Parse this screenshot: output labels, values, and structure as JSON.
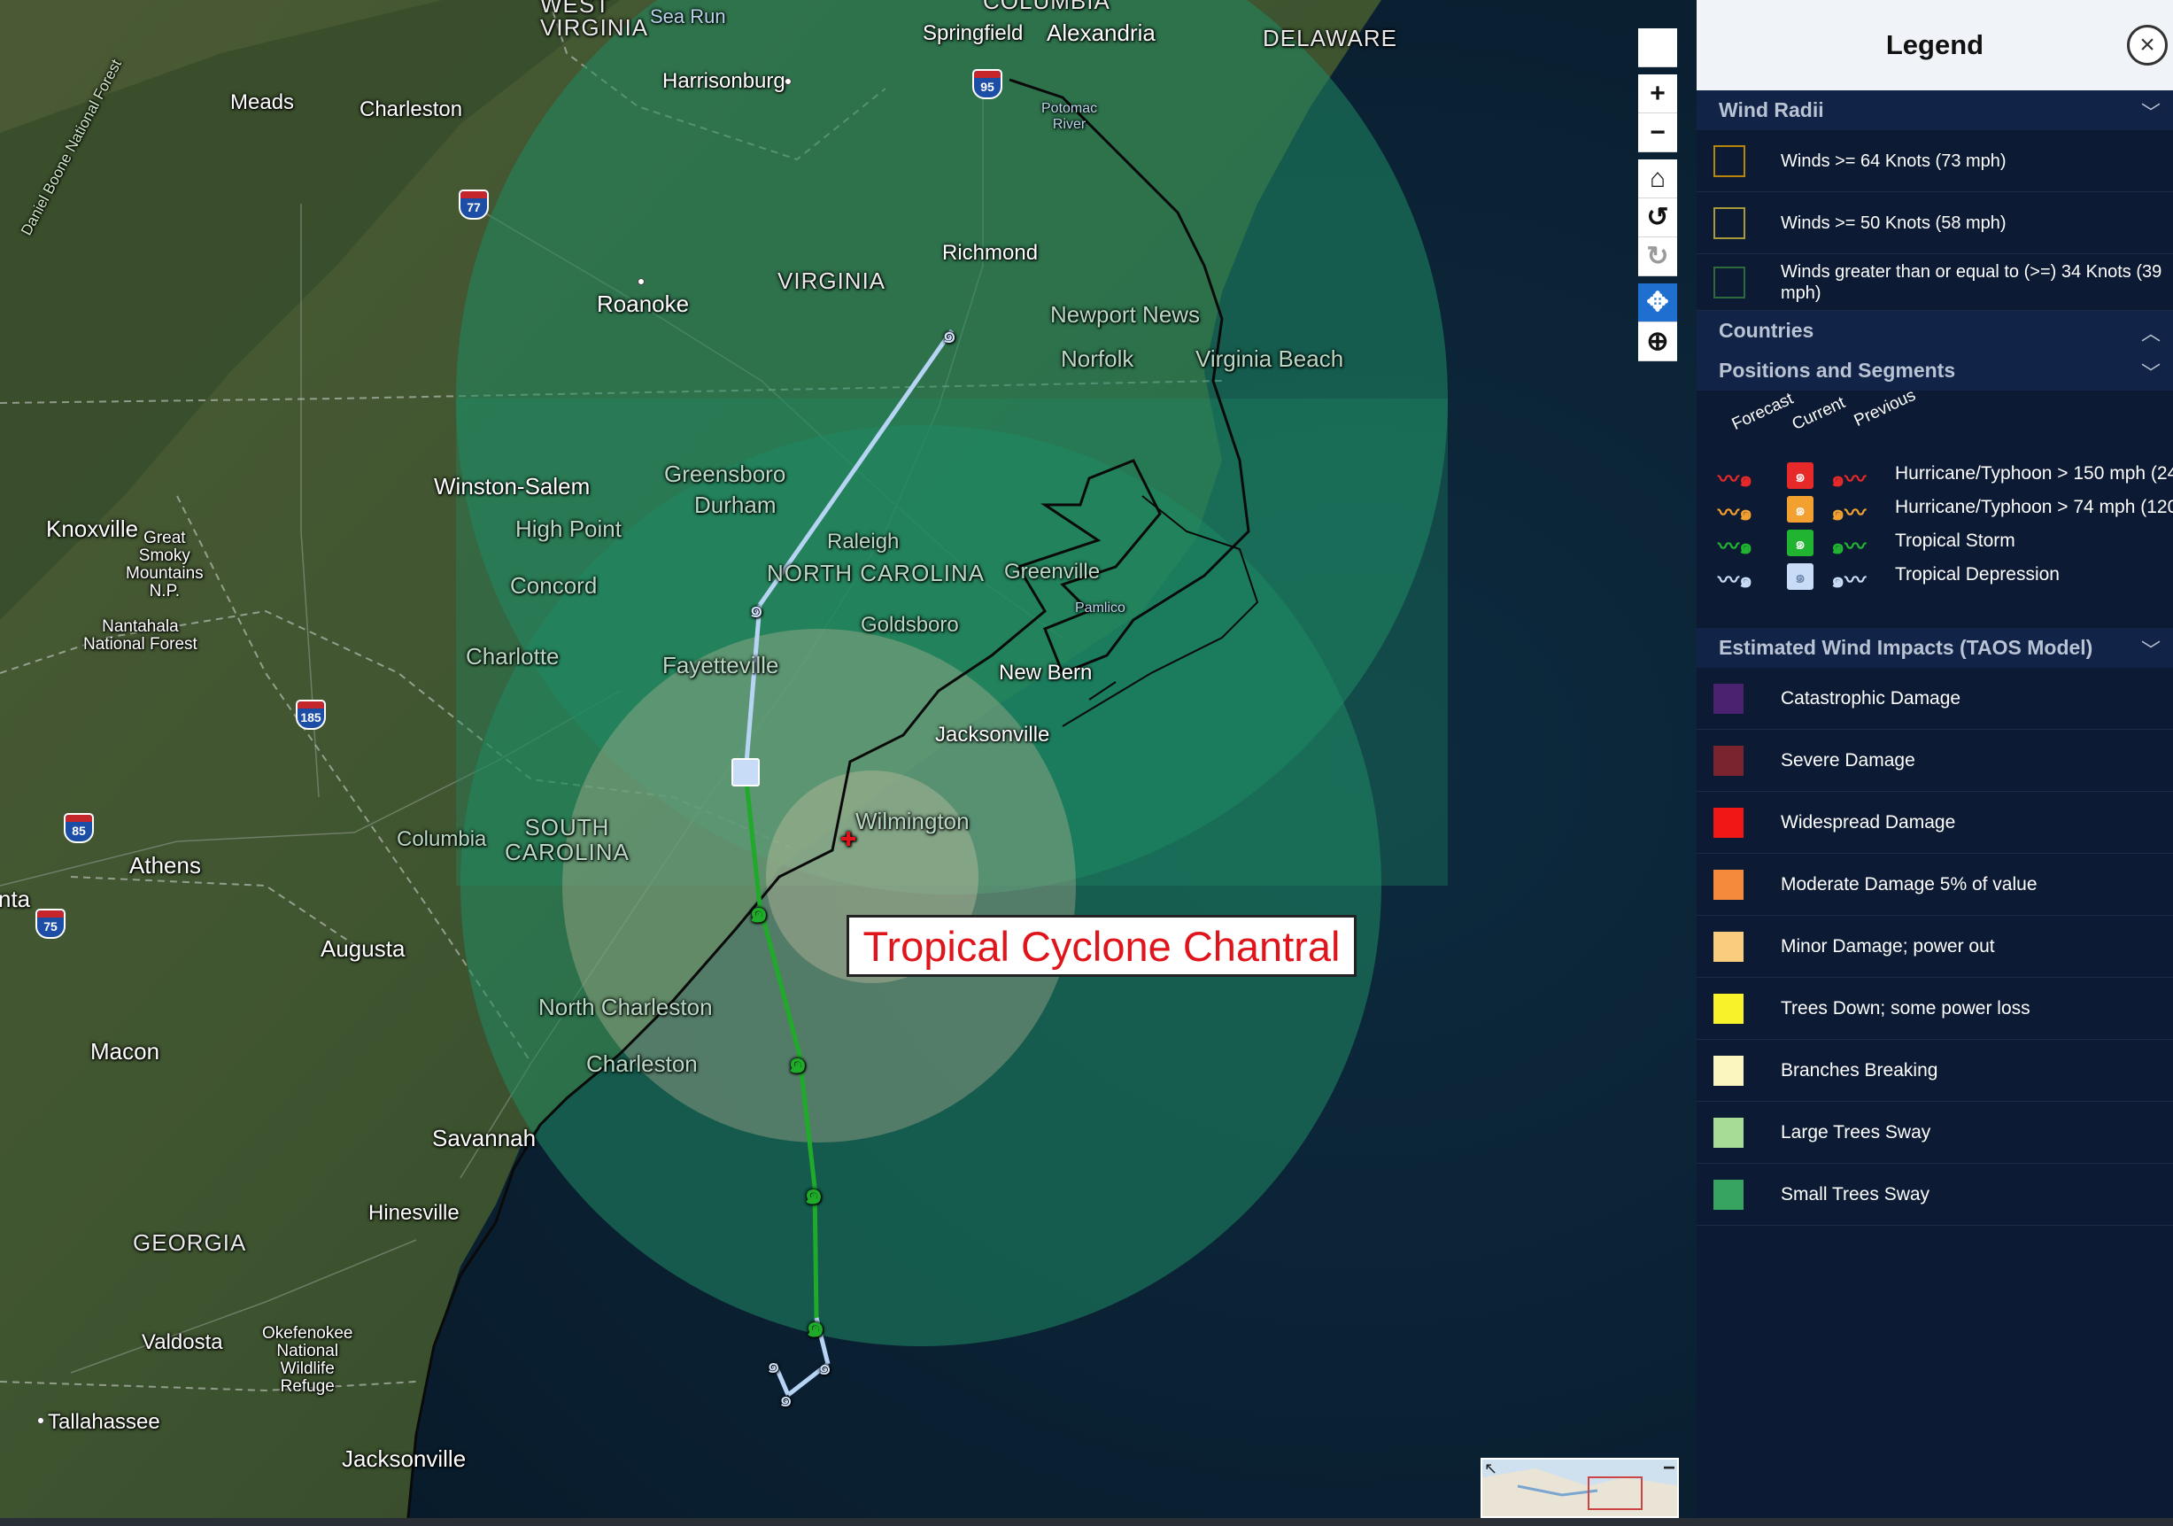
{
  "map": {
    "storm_callout": "Tropical Cyclone Chantral",
    "labels": {
      "west_virginia": "WEST\nVIRGINIA",
      "columbia_top": "COLUMBIA",
      "sea_run": "Sea Run",
      "springfield": "Springfield",
      "alexandria": "Alexandria",
      "delaware": "DELAWARE",
      "harrisonburg": "Harrisonburg",
      "meads": "Meads",
      "charleston_wv": "Charleston",
      "potomac_river": "Potomac\nRiver",
      "richmond": "Richmond",
      "virginia": "VIRGINIA",
      "roanoke": "Roanoke",
      "daniel_boone": "Daniel Boone National Forest",
      "newport_news": "Newport News",
      "norfolk": "Norfolk",
      "virginia_beach": "Virginia Beach",
      "winston_salem": "Winston-Salem",
      "greensboro": "Greensboro",
      "durham": "Durham",
      "high_point": "High Point",
      "knoxville": "Knoxville",
      "great_smoky": "Great\nSmoky\nMountains\nN.P.",
      "raleigh": "Raleigh",
      "north_carolina": "NORTH CAROLINA",
      "greenville": "Greenville",
      "concord": "Concord",
      "nantahala": "Nantahala\nNational Forest",
      "goldsboro": "Goldsboro",
      "pamlico": "Pamlico",
      "charlotte": "Charlotte",
      "fayetteville": "Fayetteville",
      "new_bern": "New Bern",
      "jacksonville_nc": "Jacksonville",
      "wilmington": "Wilmington",
      "columbia": "Columbia",
      "south_carolina": "SOUTH\nCAROLINA",
      "athens": "Athens",
      "atlanta_partial": "nta",
      "augusta": "Augusta",
      "north_charleston": "North Charleston",
      "charleston_sc": "Charleston",
      "macon": "Macon",
      "savannah": "Savannah",
      "hinesville": "Hinesville",
      "georgia": "GEORGIA",
      "valdosta": "Valdosta",
      "okefenokee": "Okefenokee\nNational\nWildlife\nRefuge",
      "tallahassee": "Tallahassee",
      "jacksonville_fl": "Jacksonville"
    },
    "shields": {
      "i95": "95",
      "i77": "77",
      "i85a": "85",
      "i185": "185",
      "i75": "75"
    },
    "toolbar": {
      "zoom_in": "+",
      "zoom_out": "−",
      "home": "⌂",
      "rotate_ccw": "↺",
      "rotate_cw": "↻",
      "pan": "✥",
      "zoom_box": "⊕"
    },
    "colors": {
      "wind_radius_34kt": "#1f8a63",
      "wind_radius_50kt": "#c8b99b",
      "track_forecast_ts": "#1faa2a",
      "track_depression": "#b8d4f4",
      "callout_text": "#e0141b"
    }
  },
  "legend": {
    "title": "Legend",
    "close_icon": "×",
    "wind_radii": {
      "heading": "Wind Radii",
      "items": [
        {
          "label": "Winds >= 64 Knots (73 mph)",
          "color": "#b8860b"
        },
        {
          "label": "Winds >= 50 Knots (58 mph)",
          "color": "#a89a3c"
        },
        {
          "label": "Winds greater than or equal to (>=) 34 Knots (39\nmph)",
          "color": "#2e6b3a"
        }
      ]
    },
    "countries": {
      "heading": "Countries"
    },
    "positions": {
      "heading": "Positions and Segments",
      "col_forecast": "Forecast",
      "col_current": "Current",
      "col_previous": "Previous",
      "rows": [
        {
          "label": "Hurricane/Typhoon > 150 mph (24",
          "color": "#e8292a"
        },
        {
          "label": "Hurricane/Typhoon > 74 mph (120",
          "color": "#f2a02f"
        },
        {
          "label": "Tropical Storm",
          "color": "#20b431"
        },
        {
          "label": "Tropical Depression",
          "color": "#c9dcf7"
        }
      ]
    },
    "impacts": {
      "heading": "Estimated Wind Impacts (TAOS Model)",
      "items": [
        {
          "label": "Catastrophic Damage",
          "color": "#4b2270"
        },
        {
          "label": "Severe Damage",
          "color": "#7a2430"
        },
        {
          "label": "Widespread Damage",
          "color": "#f21717"
        },
        {
          "label": "Moderate Damage 5% of value",
          "color": "#f58a3c"
        },
        {
          "label": "Minor Damage; power out",
          "color": "#f9cd7d"
        },
        {
          "label": "Trees Down; some power loss",
          "color": "#f7f22a"
        },
        {
          "label": "Branches Breaking",
          "color": "#fbf5c0"
        },
        {
          "label": "Large Trees Sway",
          "color": "#a6dc95"
        },
        {
          "label": "Small Trees Sway",
          "color": "#38a461"
        }
      ]
    }
  }
}
